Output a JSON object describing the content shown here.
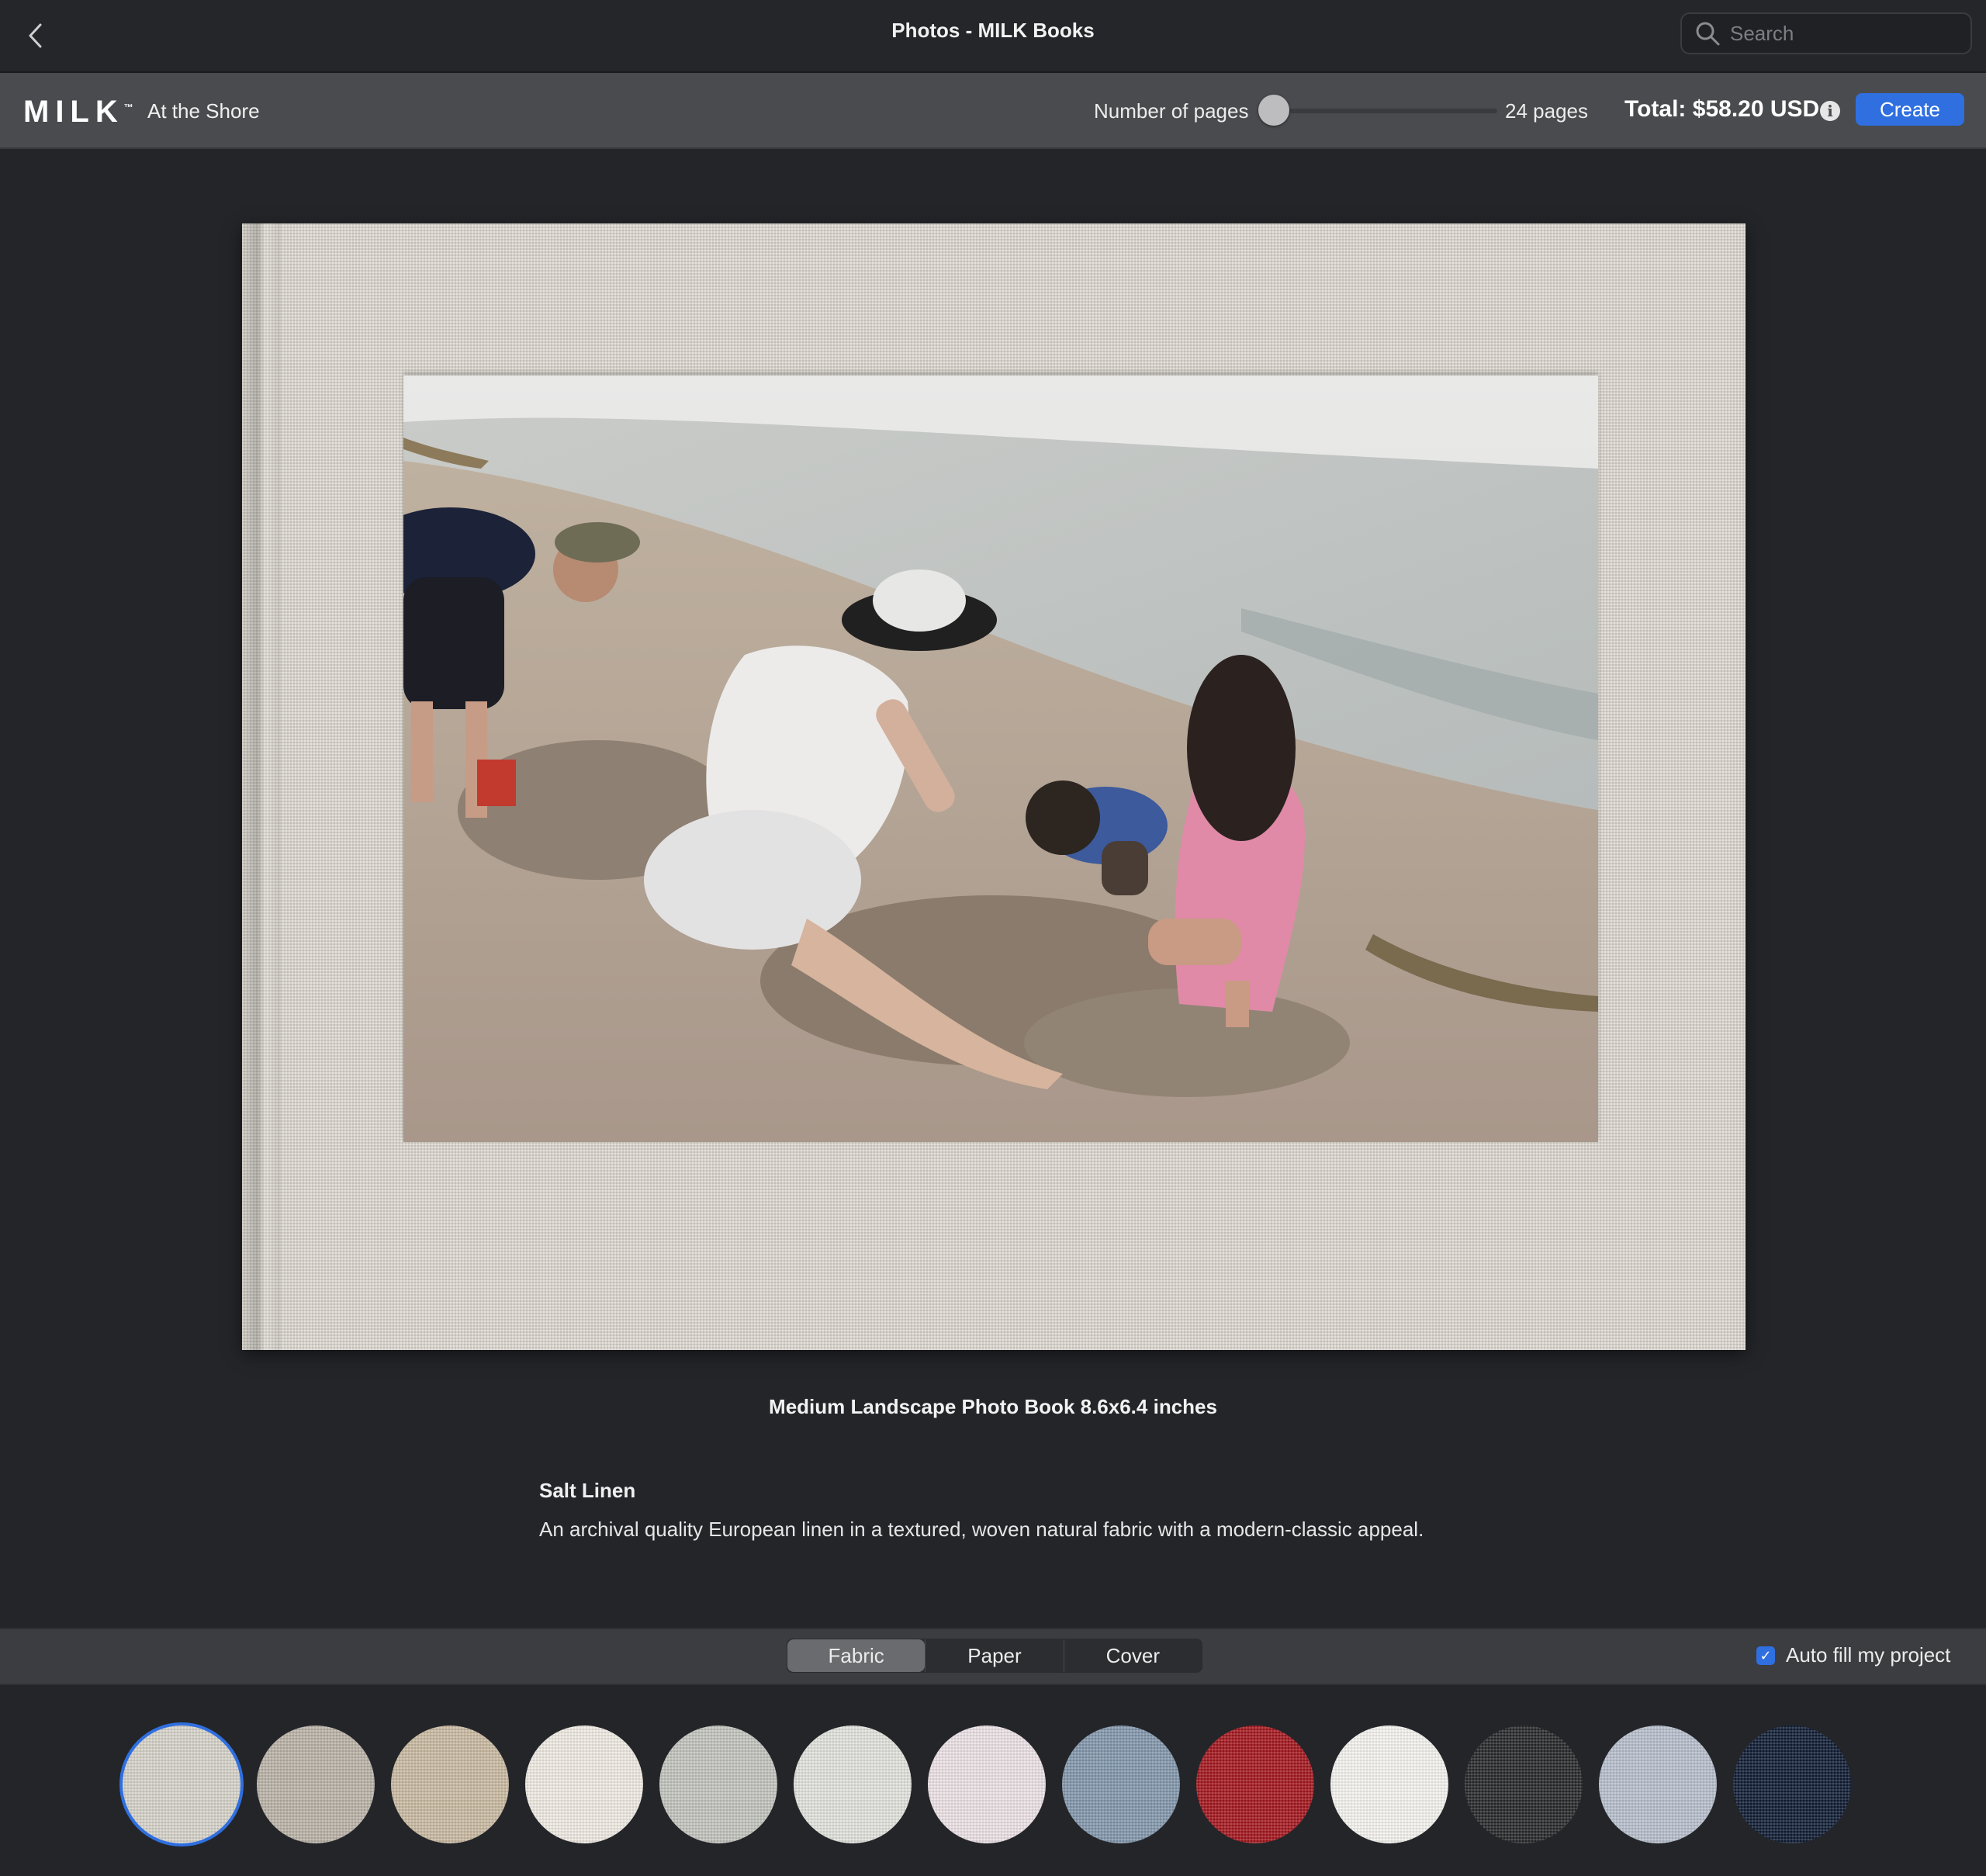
{
  "window": {
    "title": "Photos - MILK Books"
  },
  "search": {
    "placeholder": "Search"
  },
  "toolbar": {
    "brand": "MILK",
    "brand_mark": "™",
    "project_name": "At the Shore",
    "pages_label": "Number of pages",
    "pages_value": "24 pages",
    "pages_slider_fraction": 0,
    "total": "Total: $58.20 USD",
    "info_glyph": "i",
    "create_label": "Create"
  },
  "book": {
    "product_title": "Medium Landscape Photo Book 8.6x6.4 inches",
    "material_name": "Salt Linen",
    "material_description": "An archival quality European linen in a textured, woven natural fabric with a modern-classic appeal.",
    "cover_color": "#d9d5cc"
  },
  "tabs": {
    "items": [
      "Fabric",
      "Paper",
      "Cover"
    ],
    "active": "Fabric"
  },
  "autofill": {
    "label": "Auto fill my project",
    "checked": true,
    "check_glyph": "✓"
  },
  "swatches": [
    {
      "name": "swatch-1",
      "color": "#d6d2c9",
      "selected": true
    },
    {
      "name": "swatch-2",
      "color": "#b9b2a7",
      "selected": false
    },
    {
      "name": "swatch-3",
      "color": "#c9b9a1",
      "selected": false
    },
    {
      "name": "swatch-4",
      "color": "#efeae2",
      "selected": false
    },
    {
      "name": "swatch-5",
      "color": "#c2c3bd",
      "selected": false
    },
    {
      "name": "swatch-6",
      "color": "#e1e2dc",
      "selected": false
    },
    {
      "name": "swatch-7",
      "color": "#ece1e6",
      "selected": false
    },
    {
      "name": "swatch-8",
      "color": "#8196ab",
      "selected": false
    },
    {
      "name": "swatch-9",
      "color": "#a3161d",
      "selected": false
    },
    {
      "name": "swatch-10",
      "color": "#f4f3ef",
      "selected": false
    },
    {
      "name": "swatch-11",
      "color": "#262729",
      "selected": false
    },
    {
      "name": "swatch-12",
      "color": "#b7bfcc",
      "selected": false
    },
    {
      "name": "swatch-13",
      "color": "#0f1b33",
      "selected": false
    }
  ],
  "colors": {
    "accent": "#2f6fe0",
    "background": "#232529",
    "toolbar": "#4a4b4e"
  }
}
